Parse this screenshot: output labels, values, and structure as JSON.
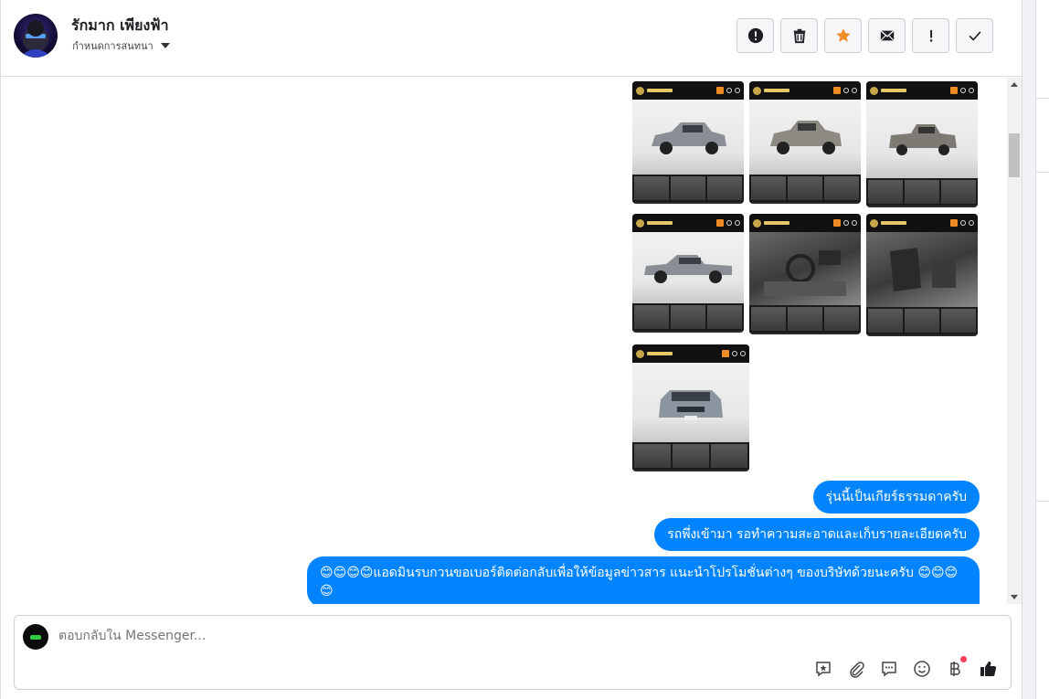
{
  "header": {
    "contact_name": "รักมาก เพียงฟ้า",
    "assign_label": "กำหนดการสนทนา",
    "actions": [
      {
        "name": "alert-button",
        "icon": "exclamation-circle-icon"
      },
      {
        "name": "delete-button",
        "icon": "trash-icon"
      },
      {
        "name": "star-button",
        "icon": "star-icon"
      },
      {
        "name": "mark-unread-button",
        "icon": "envelope-icon"
      },
      {
        "name": "spam-button",
        "icon": "exclamation-icon"
      },
      {
        "name": "done-button",
        "icon": "check-icon"
      }
    ]
  },
  "thread": {
    "photos": [
      {
        "kind": "exterior"
      },
      {
        "kind": "exterior"
      },
      {
        "kind": "exterior"
      },
      {
        "kind": "exterior"
      },
      {
        "kind": "interior"
      },
      {
        "kind": "interior"
      },
      {
        "kind": "exterior"
      }
    ],
    "messages": [
      {
        "text": "รุ่นนี้เป็นเกียร์ธรรมดาครับ"
      },
      {
        "text": "รถพึ่งเข้ามา รอทำความสะอาดและเก็บรายละเอียดครับ"
      },
      {
        "text": "😊😊😊😊แอดมินรบกวนขอเบอร์ติดต่อกลับเพื่อให้ข้อมูลข่าวสาร แนะนำโปรโมชั่นต่างๆ ของบริษัทด้วยนะครับ 😊😊😊😊"
      }
    ]
  },
  "composer": {
    "placeholder": "ตอบกลับใน Messenger..."
  },
  "colors": {
    "bubble": "#0084ff",
    "star": "#f08a24",
    "notification_dot": "#fa3e5e"
  }
}
